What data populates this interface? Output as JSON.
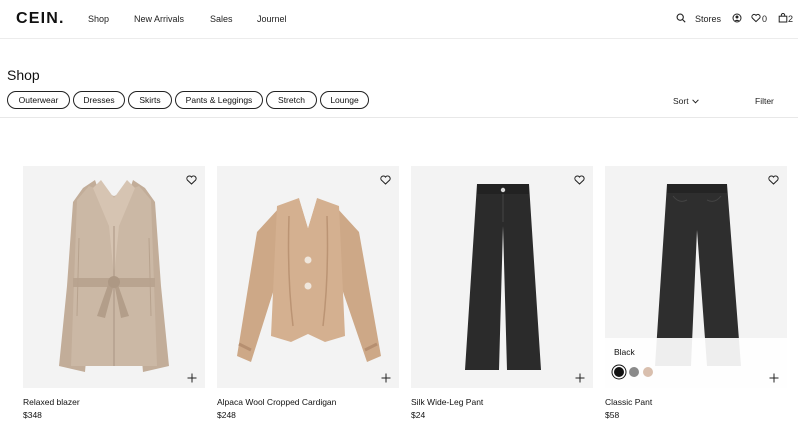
{
  "header": {
    "logo": "CEIN.",
    "nav": [
      "Shop",
      "New Arrivals",
      "Sales",
      "Journel"
    ],
    "stores_label": "Stores",
    "wishlist_count": "0",
    "bag_count": "2"
  },
  "toolbar": {
    "title": "Shop",
    "filters": [
      "Outerwear",
      "Dresses",
      "Skirts",
      "Pants & Leggings",
      "Stretch",
      "Lounge"
    ],
    "sort_label": "Sort",
    "filter_label": "Filter"
  },
  "products": [
    {
      "name": "Relaxed blazer",
      "price": "$348"
    },
    {
      "name": "Alpaca Wool Cropped Cardigan",
      "price": "$248"
    },
    {
      "name": "Silk Wide-Leg Pant",
      "price": "$24"
    },
    {
      "name": "Classic Pant",
      "price": "$58",
      "color_label": "Black",
      "swatches": [
        "#111111",
        "#8a8a8a",
        "#d9bfae"
      ]
    }
  ],
  "colors": {
    "coat": "#c9b5a2",
    "cardigan": "#d1ad8d",
    "pant": "#2b2b2b",
    "card_bg": "#f3f3f3"
  }
}
